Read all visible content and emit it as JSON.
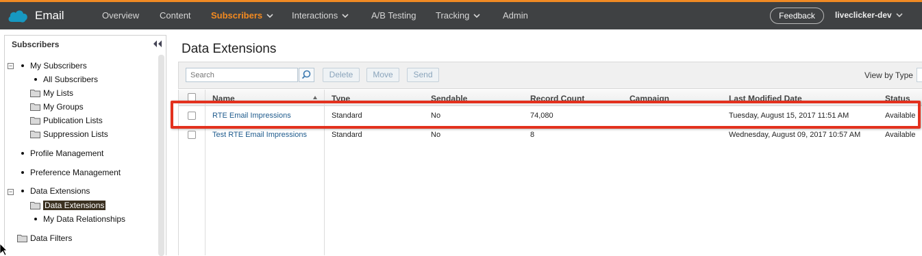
{
  "header": {
    "app_name": "Email",
    "nav": [
      {
        "label": "Overview"
      },
      {
        "label": "Content"
      },
      {
        "label": "Subscribers"
      },
      {
        "label": "Interactions"
      },
      {
        "label": "A/B Testing"
      },
      {
        "label": "Tracking"
      },
      {
        "label": "Admin"
      }
    ],
    "active_nav": "Subscribers",
    "feedback_label": "Feedback",
    "user_label": "liveclicker-dev",
    "accent_color": "#f08a24"
  },
  "sidebar": {
    "title": "Subscribers",
    "tree": [
      {
        "label": "My Subscribers"
      },
      {
        "label": "All Subscribers"
      },
      {
        "label": "My Lists"
      },
      {
        "label": "My Groups"
      },
      {
        "label": "Publication Lists"
      },
      {
        "label": "Suppression Lists"
      },
      {
        "label": "Profile Management"
      },
      {
        "label": "Preference Management"
      },
      {
        "label": "Data Extensions"
      },
      {
        "label": "Data Extensions",
        "selected": true
      },
      {
        "label": "My Data Relationships"
      },
      {
        "label": "Data Filters"
      }
    ]
  },
  "main": {
    "title": "Data Extensions",
    "search_placeholder": "Search",
    "buttons": {
      "delete": "Delete",
      "move": "Move",
      "send": "Send"
    },
    "view_by_label": "View by Type",
    "columns": [
      "Name",
      "Type",
      "Sendable",
      "Record Count",
      "Campaign",
      "Last Modified Date",
      "Status"
    ],
    "rows": [
      {
        "name": "RTE Email Impressions",
        "type": "Standard",
        "sendable": "No",
        "record_count": "74,080",
        "campaign": "",
        "last_modified": "Tuesday, August 15, 2017 11:51 AM",
        "status": "Available"
      },
      {
        "name": "Test RTE Email Impressions",
        "type": "Standard",
        "sendable": "No",
        "record_count": "8",
        "campaign": "",
        "last_modified": "Wednesday, August 09, 2017 10:57 AM",
        "status": "Available"
      }
    ],
    "highlight_color": "#e3311e"
  }
}
